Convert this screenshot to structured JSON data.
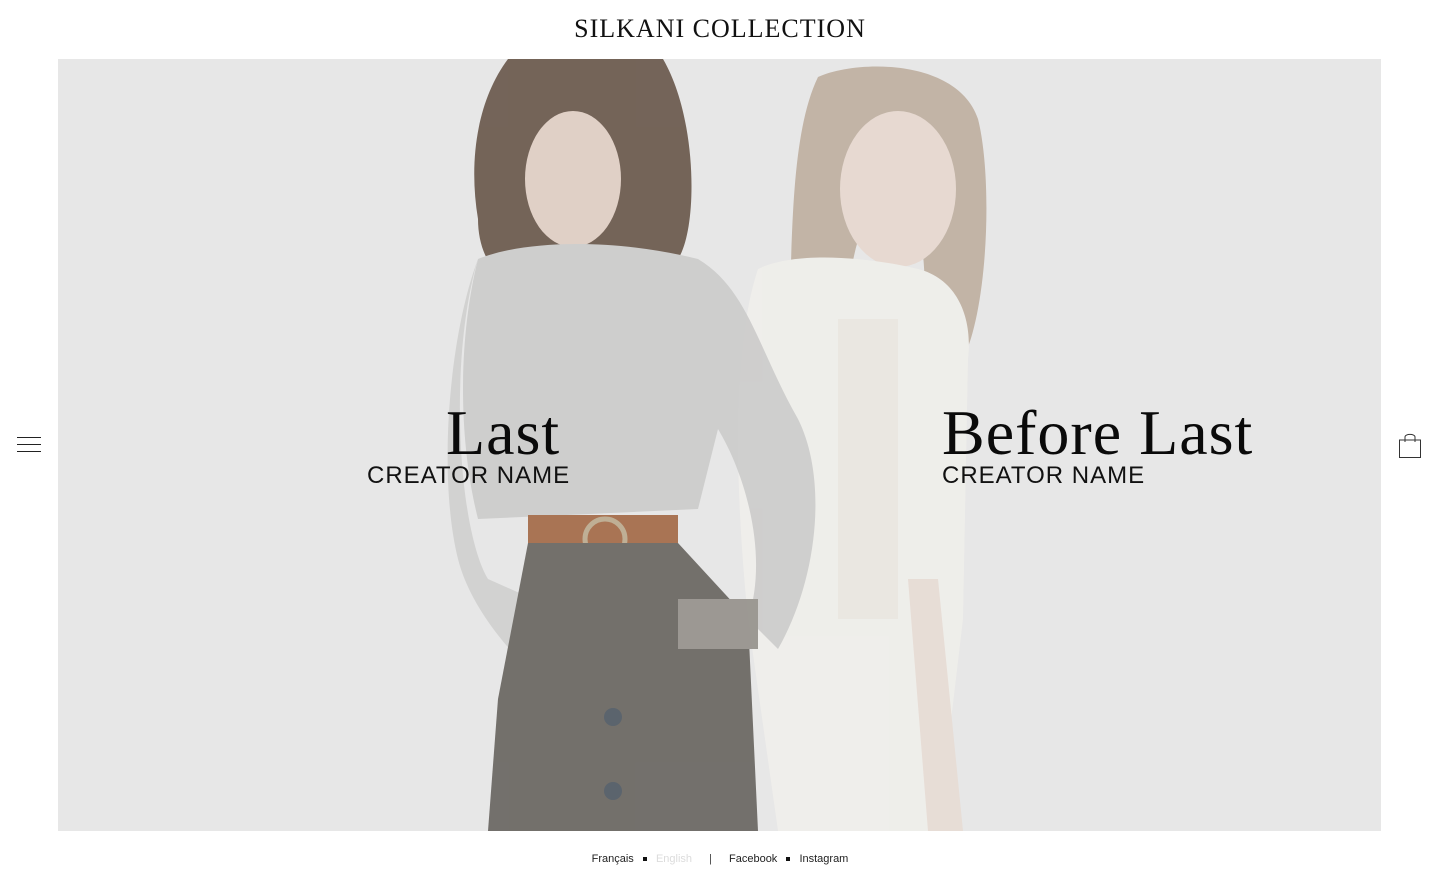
{
  "header": {
    "brand": "SILKANI COLLECTION"
  },
  "nav": {
    "menu_icon": "hamburger-menu-icon",
    "cart_icon": "shopping-bag-icon"
  },
  "slides": [
    {
      "title": "Last",
      "creator": "CREATOR NAME"
    },
    {
      "title": "Before Last",
      "creator": "CREATOR NAME"
    }
  ],
  "footer": {
    "languages": [
      "Français",
      "English"
    ],
    "active_language": "English",
    "separator": "|",
    "social": [
      "Facebook",
      "Instagram"
    ]
  },
  "colors": {
    "hero_background": "#e7e7e7",
    "text": "#111111",
    "inactive_language": "#dcdcdc"
  }
}
